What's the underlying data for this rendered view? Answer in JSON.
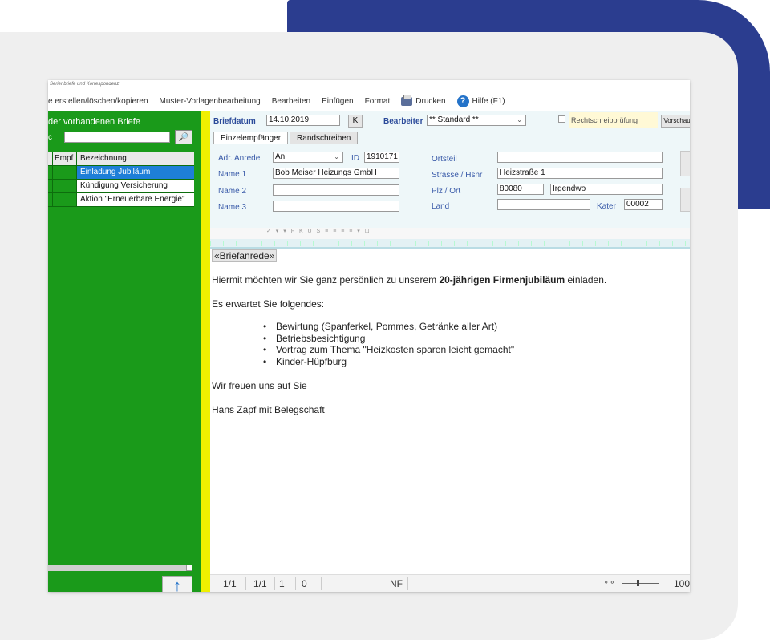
{
  "window": {
    "title": "Serienbriefe und Korrespondenz"
  },
  "menu": {
    "items": [
      "e erstellen/löschen/kopieren",
      "Muster-Vorlagenbearbeitung",
      "Bearbeiten",
      "Einfügen",
      "Format"
    ],
    "print_label": "Drucken",
    "help_label": "Hilfe (F1)"
  },
  "sidebar": {
    "title": "der vorhandenen Briefe",
    "search_label": "c",
    "search_value": "",
    "columns": [
      "Empf",
      "Bezeichnung"
    ],
    "rows": [
      {
        "empf": "",
        "label": "Einladung Jubiläum",
        "selected": true
      },
      {
        "empf": "",
        "label": "Kündigung Versicherung",
        "selected": false
      },
      {
        "empf": "",
        "label": "Aktion \"Erneuerbare Energie\"",
        "selected": false
      }
    ],
    "up_arrow": "↑",
    "down_arrow": "↓"
  },
  "form": {
    "date_label": "Briefdatum",
    "date_value": "14.10.2019",
    "k_button": "K",
    "editor_label": "Bearbeiter",
    "editor_value": "** Standard **",
    "spellcheck_label": "Rechtschreibprüfung",
    "preview_button": "Vorschau",
    "tabs": [
      "Einzelempfänger",
      "Randschreiben"
    ],
    "salutation_label": "Adr. Anrede",
    "salutation_value": "An",
    "id_label": "ID",
    "id_value": "1910171",
    "name1_label": "Name 1",
    "name1_value": "Bob Meiser Heizungs GmbH",
    "name2_label": "Name 2",
    "name2_value": "",
    "name3_label": "Name 3",
    "name3_value": "",
    "orts_label": "Ortsteil",
    "orts_value": "",
    "street_label": "Strasse / Hsnr",
    "street_value": "Heizstraße 1",
    "plz_label": "Plz / Ort",
    "plz_value": "80080",
    "city_value": "Irgendwo",
    "land_label": "Land",
    "land_value": "",
    "kat_label": "Kater",
    "kat_value": "00002"
  },
  "document": {
    "salutation_tag": "«Briefanrede»",
    "intro_before": "Hiermit möchten wir Sie ganz persönlich zu unserem ",
    "intro_bold": "20-jährigen Firmenjubiläum",
    "intro_after": " einladen.",
    "expect": "Es erwartet Sie folgendes:",
    "bullets": [
      "Bewirtung (Spanferkel, Pommes, Getränke aller Art)",
      "Betriebsbesichtigung",
      "Vortrag zum Thema \"Heizkosten sparen leicht gemacht\"",
      "Kinder-Hüpfburg"
    ],
    "closing": "Wir freuen uns auf Sie",
    "signature": "Hans Zapf mit Belegschaft"
  },
  "status": {
    "page": "1/1",
    "section": "1/1",
    "line": "1",
    "col": "0",
    "mode": "NF",
    "zoom": "100"
  }
}
